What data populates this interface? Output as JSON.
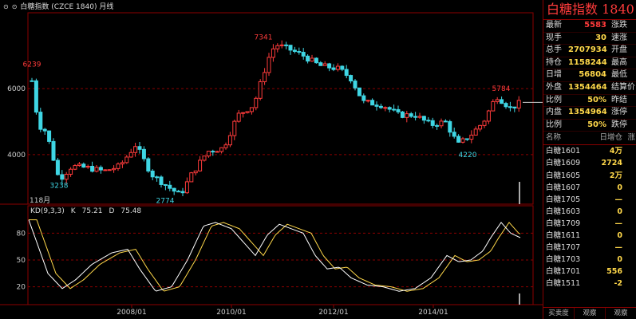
{
  "window": {
    "title": "白糖指数 (CZCE 1840) 月线"
  },
  "colors": {
    "up": "#ff3b3b",
    "down": "#3fd6e4",
    "grid": "#8b0000",
    "k_line": "#ffffff",
    "d_line": "#ffd84a"
  },
  "chart_data": [
    {
      "type": "candlestick",
      "title": "白糖指数 (CZCE 1840) 月线",
      "x_ticks": [
        "2008/01",
        "2010/01",
        "2012/01",
        "2014/01"
      ],
      "y_ticks": [
        4000,
        6000
      ],
      "ylim": [
        2500,
        8300
      ],
      "annotations": [
        {
          "label": "6239",
          "value": 6239
        },
        {
          "label": "3238",
          "value": 3238
        },
        {
          "label": "2774",
          "value": 2774
        },
        {
          "label": "7341",
          "value": 7341
        },
        {
          "label": "5784",
          "value": 5784
        },
        {
          "label": "4220",
          "value": 4220
        }
      ],
      "volume_label": "118月"
    },
    {
      "type": "line",
      "title": "KD(9,3,3)",
      "legend": [
        {
          "name": "K",
          "value": "75.21"
        },
        {
          "name": "D",
          "value": "75.48"
        }
      ],
      "y_ticks": [
        20,
        50,
        80
      ],
      "ylim": [
        0,
        100
      ]
    }
  ],
  "quote_panel": {
    "title": "白糖指数",
    "code": "1840",
    "rows": [
      {
        "label": "最新",
        "value": "5583",
        "color": "red",
        "label2": "涨跌"
      },
      {
        "label": "现手",
        "value": "30",
        "color": "yellow",
        "label2": "速涨"
      },
      {
        "label": "总手",
        "value": "2707934",
        "color": "yellow",
        "label2": "开盘"
      },
      {
        "label": "持仓",
        "value": "1158244",
        "color": "yellow",
        "label2": "最高"
      },
      {
        "label": "日增",
        "value": "56804",
        "color": "yellow",
        "label2": "最低"
      },
      {
        "label": "外盘",
        "value": "1354464",
        "color": "yellow",
        "label2": "结算价"
      },
      {
        "label": "比例",
        "value": "50%",
        "color": "yellow",
        "label2": "昨结"
      },
      {
        "label": "内盘",
        "value": "1354964",
        "color": "yellow",
        "label2": "涨停"
      },
      {
        "label": "比例",
        "value": "50%",
        "color": "yellow",
        "label2": "跌停"
      }
    ]
  },
  "contract_list": {
    "headers": [
      "名称",
      "日增仓",
      "涨"
    ],
    "rows": [
      {
        "name": "白糖1601",
        "value": "4万",
        "color": "yellow"
      },
      {
        "name": "白糖1609",
        "value": "2724",
        "color": "yellow"
      },
      {
        "name": "白糖1605",
        "value": "2万",
        "color": "yellow"
      },
      {
        "name": "白糖1607",
        "value": "0",
        "color": "yellow"
      },
      {
        "name": "白糖1705",
        "value": "—",
        "color": "yellow"
      },
      {
        "name": "白糖1603",
        "value": "0",
        "color": "yellow"
      },
      {
        "name": "白糖1709",
        "value": "—",
        "color": "yellow"
      },
      {
        "name": "白糖1611",
        "value": "0",
        "color": "yellow"
      },
      {
        "name": "白糖1707",
        "value": "—",
        "color": "yellow"
      },
      {
        "name": "白糖1703",
        "value": "0",
        "color": "yellow"
      },
      {
        "name": "白糖1701",
        "value": "556",
        "color": "yellow"
      },
      {
        "name": "白糖1511",
        "value": "-2",
        "color": "yellow"
      }
    ]
  },
  "bottom_tabs": [
    "买卖度",
    "观察",
    "观察"
  ]
}
